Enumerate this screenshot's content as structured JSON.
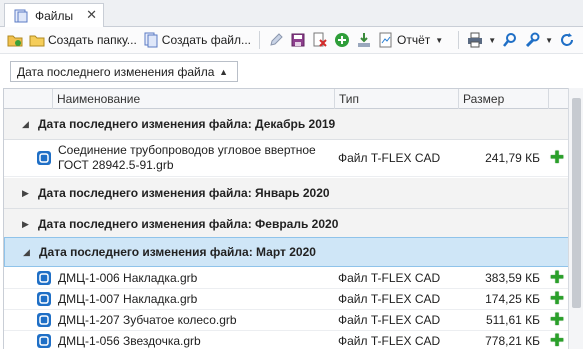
{
  "tab": {
    "title": "Файлы",
    "close_glyph": "✕"
  },
  "toolbar": {
    "new_folder_label": "Создать папку...",
    "new_file_label": "Создать файл...",
    "report_label": "Отчёт"
  },
  "grouping": {
    "chip_label": "Дата последнего изменения файла"
  },
  "columns": {
    "name": "Наименование",
    "type": "Тип",
    "size": "Размер"
  },
  "groups": [
    {
      "label": "Дата последнего изменения файла: Декабрь 2019",
      "expanded": true
    },
    {
      "label": "Дата последнего изменения файла: Январь 2020",
      "expanded": false
    },
    {
      "label": "Дата последнего изменения файла: Февраль 2020",
      "expanded": false
    },
    {
      "label": "Дата последнего изменения файла: Март 2020",
      "expanded": true,
      "selected": true
    }
  ],
  "files": [
    {
      "name_line1": "Соединение трубопроводов угловое ввертное",
      "name_line2": "ГОСТ 28942.5-91.grb",
      "type": "Файл T-FLEX CAD",
      "size": "241,79 КБ"
    },
    {
      "name": "ДМЦ-1-006 Накладка.grb",
      "type": "Файл T-FLEX CAD",
      "size": "383,59 КБ"
    },
    {
      "name": "ДМЦ-1-007 Накладка.grb",
      "type": "Файл T-FLEX CAD",
      "size": "174,25 КБ"
    },
    {
      "name": "ДМЦ-1-207 Зубчатое колесо.grb",
      "type": "Файл T-FLEX CAD",
      "size": "511,61 КБ"
    },
    {
      "name": "ДМЦ-1-056 Звездочка.grb",
      "type": "Файл T-FLEX CAD",
      "size": "778,21 КБ"
    }
  ]
}
